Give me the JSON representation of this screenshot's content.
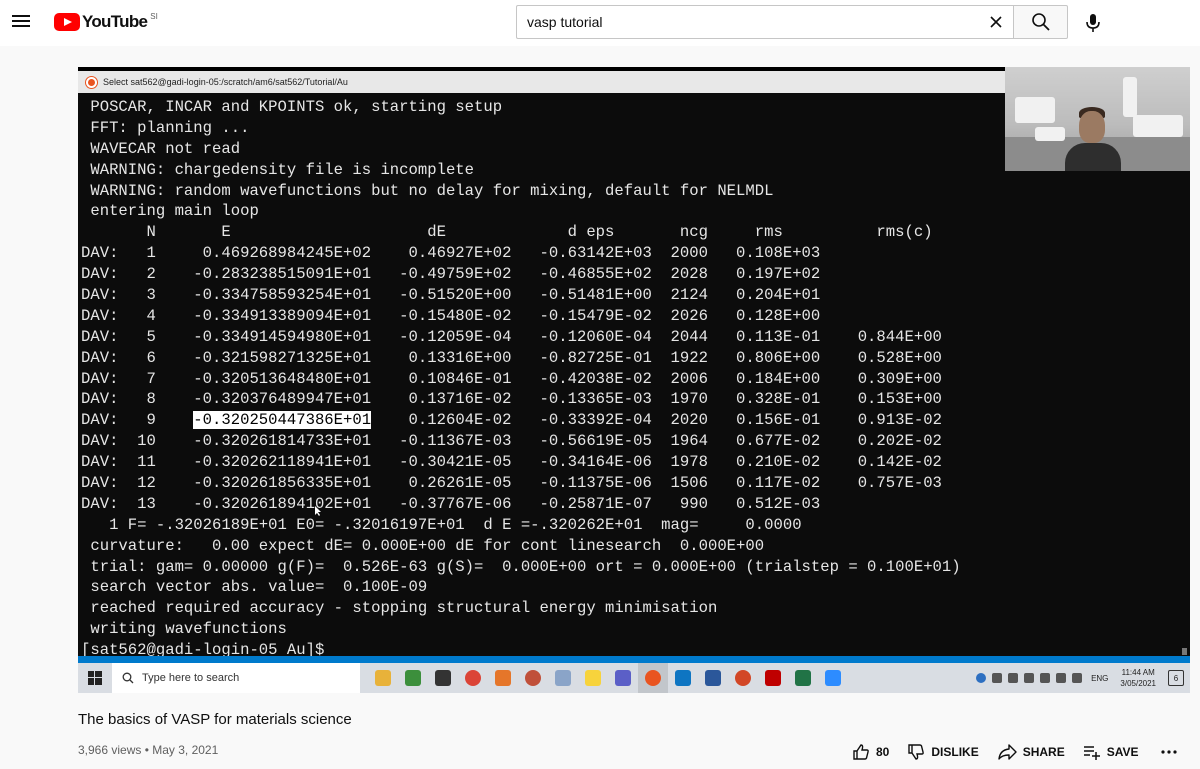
{
  "header": {
    "logo_text": "YouTube",
    "logo_country": "SI",
    "search": {
      "value": "vasp tutorial",
      "placeholder": "Search"
    }
  },
  "player": {
    "terminal_title": "Select sat562@gadi-login-05:/scratch/am6/sat562/Tutorial/Au",
    "terminal_lines": [
      " POSCAR, INCAR and KPOINTS ok, starting setup",
      " FFT: planning ...",
      " WAVECAR not read",
      " WARNING: chargedensity file is incomplete",
      " WARNING: random wavefunctions but no delay for mixing, default for NELMDL",
      " entering main loop",
      "       N       E                     dE             d eps       ncg     rms          rms(c)",
      "DAV:   1     0.469268984245E+02    0.46927E+02   -0.63142E+03  2000   0.108E+03",
      "DAV:   2    -0.283238515091E+01   -0.49759E+02   -0.46855E+02  2028   0.197E+02",
      "DAV:   3    -0.334758593254E+01   -0.51520E+00   -0.51481E+00  2124   0.204E+01",
      "DAV:   4    -0.334913389094E+01   -0.15480E-02   -0.15479E-02  2026   0.128E+00",
      "DAV:   5    -0.334914594980E+01   -0.12059E-04   -0.12060E-04  2044   0.113E-01    0.844E+00",
      "DAV:   6    -0.321598271325E+01    0.13316E+00   -0.82725E-01  1922   0.806E+00    0.528E+00",
      "DAV:   7    -0.320513648480E+01    0.10846E-01   -0.42038E-02  2006   0.184E+00    0.309E+00",
      "DAV:   8    -0.320376489947E+01    0.13716E-02   -0.13365E-03  1970   0.328E-01    0.153E+00",
      "DAV:   9    |-0.320250447386E+01|    0.12604E-02   -0.33392E-04  2020   0.156E-01    0.913E-02",
      "DAV:  10    -0.320261814733E+01   -0.11367E-03   -0.56619E-05  1964   0.677E-02    0.202E-02",
      "DAV:  11    -0.320262118941E+01   -0.30421E-05   -0.34164E-06  1978   0.210E-02    0.142E-02",
      "DAV:  12    -0.320261856335E+01    0.26261E-05   -0.11375E-06  1506   0.117E-02    0.757E-03",
      "DAV:  13    -0.320261894102E+01   -0.37767E-06   -0.25871E-07   990   0.512E-03",
      "   1 F= -.32026189E+01 E0= -.32016197E+01  d E =-.320262E+01  mag=     0.0000",
      " curvature:   0.00 expect dE= 0.000E+00 dE for cont linesearch  0.000E+00",
      " trial: gam= 0.00000 g(F)=  0.526E-63 g(S)=  0.000E+00 ort = 0.000E+00 (trialstep = 0.100E+01)",
      " search vector abs. value=  0.100E-09",
      " reached required accuracy - stopping structural energy minimisation",
      " writing wavefunctions",
      "[sat562@gadi-login-05 Au]$"
    ],
    "taskbar": {
      "search_placeholder": "Type here to search",
      "language": "ENG",
      "time": "11:44 AM",
      "date": "3/05/2021",
      "notification_count": "6"
    }
  },
  "video": {
    "title": "The basics of VASP for materials science",
    "meta": "3,966 views • May 3, 2021",
    "like_count": "80",
    "dislike_label": "DISLIKE",
    "share_label": "SHARE",
    "save_label": "SAVE"
  },
  "colors": {
    "youtube_red": "#ff0000",
    "terminal_bg": "#0c0c0c",
    "terminal_fg": "#e6e6e6",
    "vscode_status": "#007acc"
  }
}
